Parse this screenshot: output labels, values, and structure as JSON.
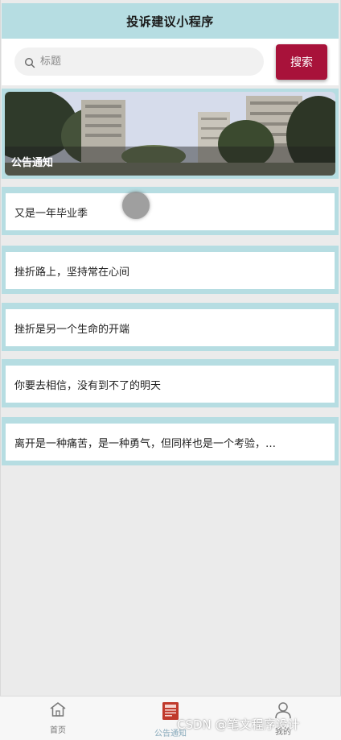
{
  "header": {
    "title": "投诉建议小程序"
  },
  "search": {
    "placeholder": "标题",
    "value": "",
    "button_label": "搜索"
  },
  "banner": {
    "caption": "公告通知"
  },
  "notices": [
    {
      "title": "又是一年毕业季"
    },
    {
      "title": "挫折路上，坚持常在心间"
    },
    {
      "title": "挫折是另一个生命的开端"
    },
    {
      "title": "你要去相信，没有到不了的明天"
    },
    {
      "title": "离开是一种痛苦，是一种勇气，但同样也是一个考验，…"
    }
  ],
  "tabbar": {
    "items": [
      {
        "label": "首页",
        "icon": "home-icon"
      },
      {
        "label": "公告通知",
        "icon": "notice-icon",
        "active": true
      },
      {
        "label": "我的",
        "icon": "user-icon"
      }
    ]
  },
  "watermark": "CSDN @笔文程序设计",
  "colors": {
    "header_bg": "#b6dde2",
    "accent": "#a8123a",
    "notice_icon": "#c0392b"
  }
}
